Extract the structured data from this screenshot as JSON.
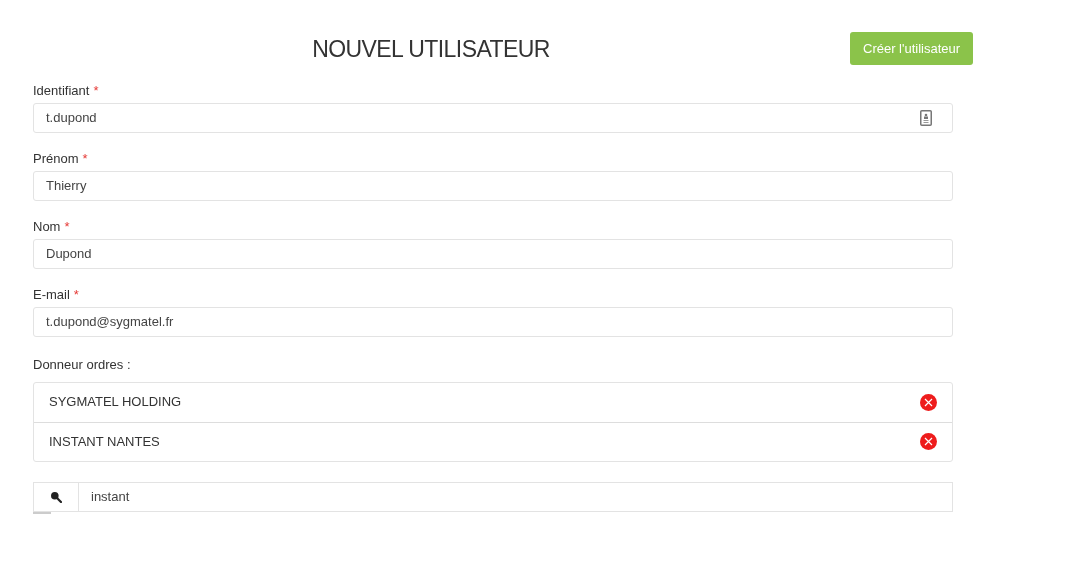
{
  "title": "NOUVEL UTILISATEUR",
  "create_button": "Créer l'utilisateur",
  "fields": [
    {
      "kind": "identifier",
      "label": "Identifiant",
      "required_mark": "*",
      "value": "t.dupond"
    },
    {
      "kind": "text",
      "label": "Prénom",
      "required_mark": "*",
      "value": "Thierry"
    },
    {
      "kind": "text",
      "label": "Nom",
      "required_mark": "*",
      "value": "Dupond"
    },
    {
      "kind": "text",
      "label": "E-mail",
      "required_mark": "*",
      "value": "t.dupond@sygmatel.fr"
    }
  ],
  "donneur_ordres": {
    "label": "Donneur ordres :",
    "items": [
      "SYGMATEL HOLDING",
      "INSTANT NANTES"
    ],
    "search": {
      "value": "instant"
    }
  }
}
